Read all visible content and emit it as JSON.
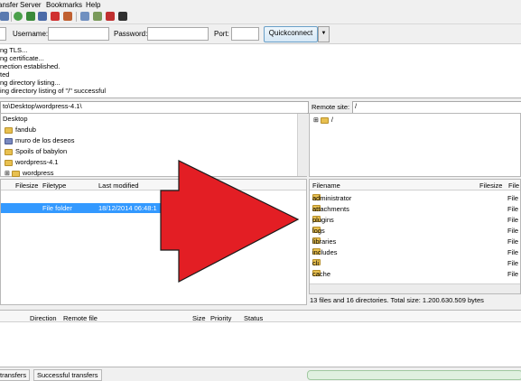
{
  "menubar": {
    "items": [
      "ansfer",
      "Server",
      "Bookmarks",
      "Help"
    ]
  },
  "toolbar": {
    "icons": [
      "site-manager-icon",
      "refresh-icon",
      "process-queue-icon",
      "cancel-icon",
      "disconnect-icon",
      "reconnect-icon",
      "compare-icon",
      "sync-browse-icon",
      "search-icon",
      "binoculars-icon"
    ]
  },
  "quickconnect": {
    "username_label": "Username:",
    "password_label": "Password:",
    "port_label": "Port:",
    "button_label": "Quickconnect",
    "dropdown_glyph": "▼"
  },
  "log": {
    "lines": [
      "ng TLS...",
      "ng certificate...",
      "nection established.",
      "ted",
      "ng directory listing...",
      "ing directory listing of \"/\" successful"
    ]
  },
  "local": {
    "site_path": "to\\Desktop\\wordpress-4.1\\",
    "tree": [
      "Desktop",
      "fandub",
      "muro de los deseos",
      "Spoils of babylon",
      "wordpress-4.1",
      "wordpress"
    ],
    "columns": {
      "filesize": "Filesize",
      "filetype": "Filetype",
      "last_modified": "Last modified"
    },
    "rows": [
      {
        "filetype": "File folder",
        "last_modified": "18/12/2014 06:48:1"
      }
    ]
  },
  "remote": {
    "site_label": "Remote site:",
    "site_path": "/",
    "tree": [
      "/"
    ],
    "columns": {
      "filename": "Filename",
      "filesize": "Filesize",
      "filetype": "File"
    },
    "rows": [
      {
        "name": "administrator",
        "type": "File"
      },
      {
        "name": "attachments",
        "type": "File"
      },
      {
        "name": "plugins",
        "type": "File"
      },
      {
        "name": "logs",
        "type": "File"
      },
      {
        "name": "libraries",
        "type": "File"
      },
      {
        "name": "includes",
        "type": "File"
      },
      {
        "name": "cli",
        "type": "File"
      },
      {
        "name": "cache",
        "type": "File"
      }
    ],
    "status": "13 files and 16 directories. Total size: 1.200.630.509 bytes"
  },
  "queue": {
    "columns": {
      "direction": "Direction",
      "remote_file": "Remote file",
      "size": "Size",
      "priority": "Priority",
      "status": "Status"
    },
    "tabs": [
      "transfers",
      "Successful transfers"
    ]
  },
  "colors": {
    "arrow": "#e31e24",
    "selection": "#3399ff",
    "folder": "#e8c050"
  }
}
